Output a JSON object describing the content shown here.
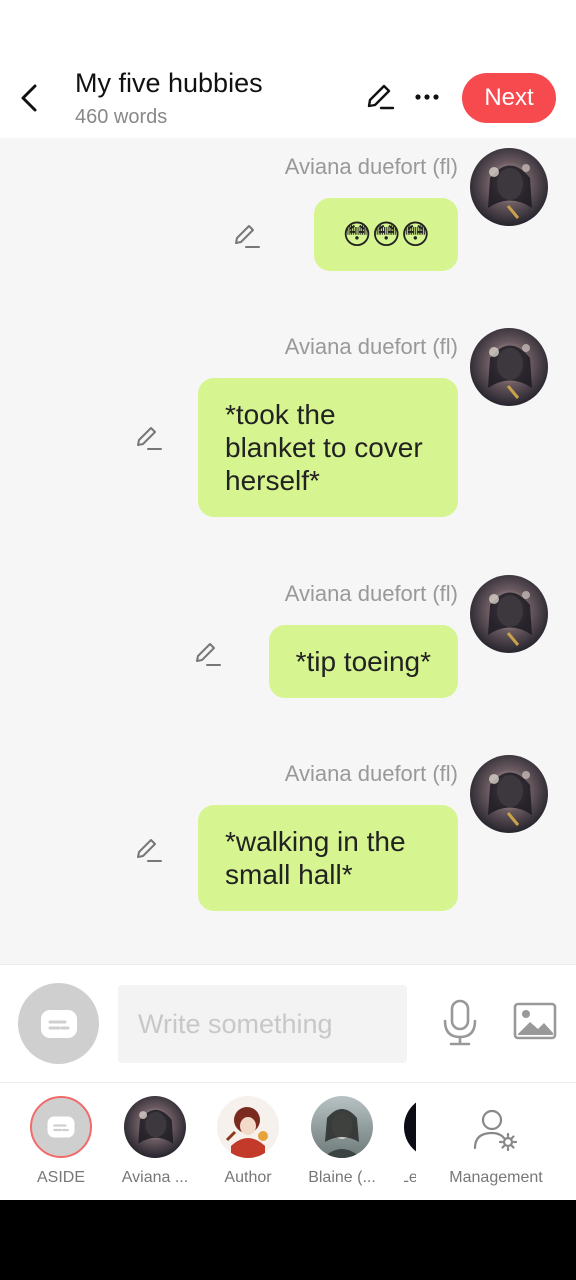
{
  "header": {
    "title": "My five hubbies",
    "word_count": "460 words",
    "next_label": "Next",
    "next_color": "#f64a4f"
  },
  "messages": [
    {
      "sender": "Aviana duefort (fl)",
      "text": "😳😳😳"
    },
    {
      "sender": "Aviana duefort (fl)",
      "text": "*took the blanket to cover herself*"
    },
    {
      "sender": "Aviana duefort (fl)",
      "text": "*tip toeing*"
    },
    {
      "sender": "Aviana duefort (fl)",
      "text": "*walking in the small hall*"
    }
  ],
  "bubble_color": "#d6f48f",
  "composer": {
    "placeholder": "Write something"
  },
  "roster": [
    {
      "label": "ASIDE"
    },
    {
      "label": "Aviana ..."
    },
    {
      "label": "Author"
    },
    {
      "label": "Blaine (..."
    },
    {
      "label": "Le"
    },
    {
      "label": "Management"
    }
  ]
}
